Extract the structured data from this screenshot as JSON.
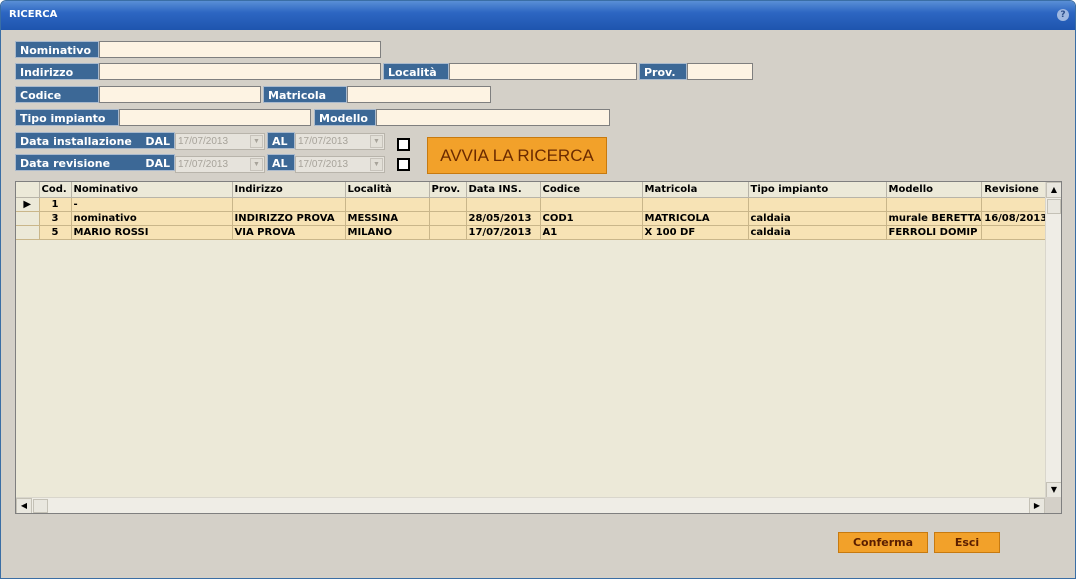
{
  "window": {
    "title": "RICERCA",
    "help": "?"
  },
  "form": {
    "nominativo": {
      "label": "Nominativo",
      "value": ""
    },
    "indirizzo": {
      "label": "Indirizzo",
      "value": ""
    },
    "localita": {
      "label": "Località",
      "value": ""
    },
    "prov": {
      "label": "Prov.",
      "value": ""
    },
    "codice": {
      "label": "Codice",
      "value": ""
    },
    "matricola": {
      "label": "Matricola",
      "value": ""
    },
    "tipo_impianto": {
      "label": "Tipo impianto",
      "value": ""
    },
    "modello": {
      "label": "Modello",
      "value": ""
    },
    "data_installazione": {
      "label": "Data installazione",
      "dal_label": "DAL",
      "al_label": "AL",
      "dal": "17/07/2013",
      "al": "17/07/2013",
      "checked": false
    },
    "data_revisione": {
      "label": "Data revisione",
      "dal_label": "DAL",
      "al_label": "AL",
      "dal": "17/07/2013",
      "al": "17/07/2013",
      "checked": false
    },
    "search_button": "AVVIA LA RICERCA"
  },
  "grid": {
    "columns": [
      "Cod.",
      "Nominativo",
      "Indirizzo",
      "Località",
      "Prov.",
      "Data INS.",
      "Codice",
      "Matricola",
      "Tipo impianto",
      "Modello",
      "Revisione"
    ],
    "rows": [
      {
        "current": true,
        "cells": [
          "1",
          "-",
          "",
          "",
          "",
          "",
          "",
          "",
          "",
          "",
          ""
        ]
      },
      {
        "current": false,
        "cells": [
          "3",
          "nominativo",
          "INDIRIZZO PROVA",
          "MESSINA",
          "",
          "28/05/2013",
          "COD1",
          "MATRICOLA",
          "caldaia",
          "murale BERETTA",
          "16/08/2013"
        ]
      },
      {
        "current": false,
        "cells": [
          "5",
          "MARIO ROSSI",
          "VIA PROVA",
          "MILANO",
          "",
          "17/07/2013",
          "A1",
          "X 100 DF",
          "caldaia",
          "FERROLI DOMIP",
          ""
        ]
      }
    ]
  },
  "buttons": {
    "confirm": "Conferma",
    "exit": "Esci"
  },
  "colors": {
    "label_bg": "#3c6896",
    "input_bg": "#fdf3e3",
    "row_bg": "#f7e3b5",
    "accent_orange": "#f2a12a",
    "titlebar": "#2d66c2"
  }
}
